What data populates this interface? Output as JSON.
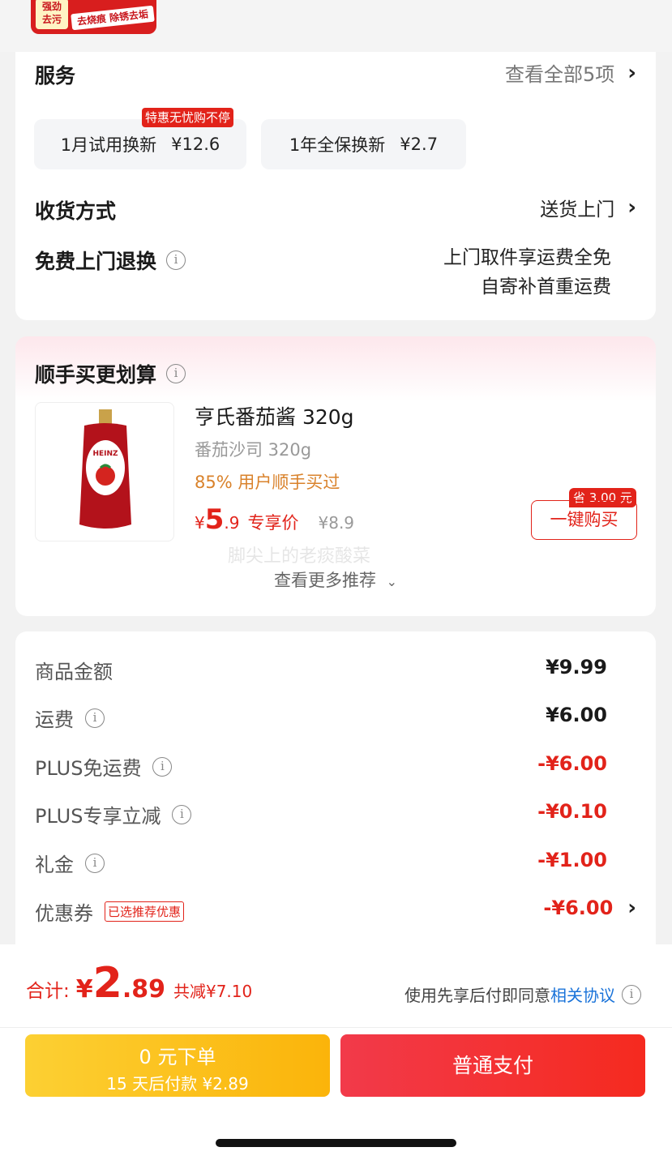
{
  "top_banner": {
    "badge_text": "强劲\n去污",
    "slogan": "去烧痕 除锈去垢"
  },
  "service": {
    "title": "服务",
    "view_all": "查看全部5项",
    "promo_tag": "特惠无忧购不停",
    "options": [
      {
        "label": "1月试用换新",
        "price": "¥12.6"
      },
      {
        "label": "1年全保换新",
        "price": "¥2.7"
      }
    ]
  },
  "delivery": {
    "label": "收货方式",
    "value": "送货上门"
  },
  "returns": {
    "label": "免费上门退换",
    "line1": "上门取件享运费全免",
    "line2": "自寄补首重运费"
  },
  "addon": {
    "title": "顺手买更划算",
    "product_name": "亨氏番茄酱 320g",
    "product_spec": "番茄沙司 320g",
    "social_proof": "85% 用户顺手买过",
    "currency": "¥",
    "price_int": "5",
    "price_dec": ".9",
    "exclusive_label": "专享价",
    "original_price": "¥8.9",
    "save_tag": "省 3.00 元",
    "buy_button": "一键购买",
    "watermark": "脚尖上的老痰酸菜",
    "more": "查看更多推荐"
  },
  "summary": {
    "rows": [
      {
        "label": "商品金额",
        "value": "¥9.99",
        "info": false,
        "red": false
      },
      {
        "label": "运费",
        "value": "¥6.00",
        "info": true,
        "red": false
      },
      {
        "label": "PLUS免运费",
        "value": "-¥6.00",
        "info": true,
        "red": true
      },
      {
        "label": "PLUS专享立减",
        "value": "-¥0.10",
        "info": true,
        "red": true
      },
      {
        "label": "礼金",
        "value": "-¥1.00",
        "info": true,
        "red": true
      }
    ],
    "coupon_label": "优惠券",
    "coupon_tag": "已选推荐优惠",
    "coupon_value": "-¥6.00"
  },
  "footer": {
    "total_label": "合计:",
    "total_currency": "¥",
    "total_int": "2",
    "total_dec": ".89",
    "discount": "共减¥7.10",
    "agreement_prefix": "使用先享后付即同意",
    "agreement_link": "相关协议",
    "pay_later_title": "0 元下单",
    "pay_later_sub": "15 天后付款 ¥2.89",
    "pay_normal": "普通支付"
  },
  "colors": {
    "accent_red": "#e2231a",
    "orange_text": "#d9822b",
    "link_blue": "#1a73d9",
    "yellow_button": "#fbbf12"
  }
}
